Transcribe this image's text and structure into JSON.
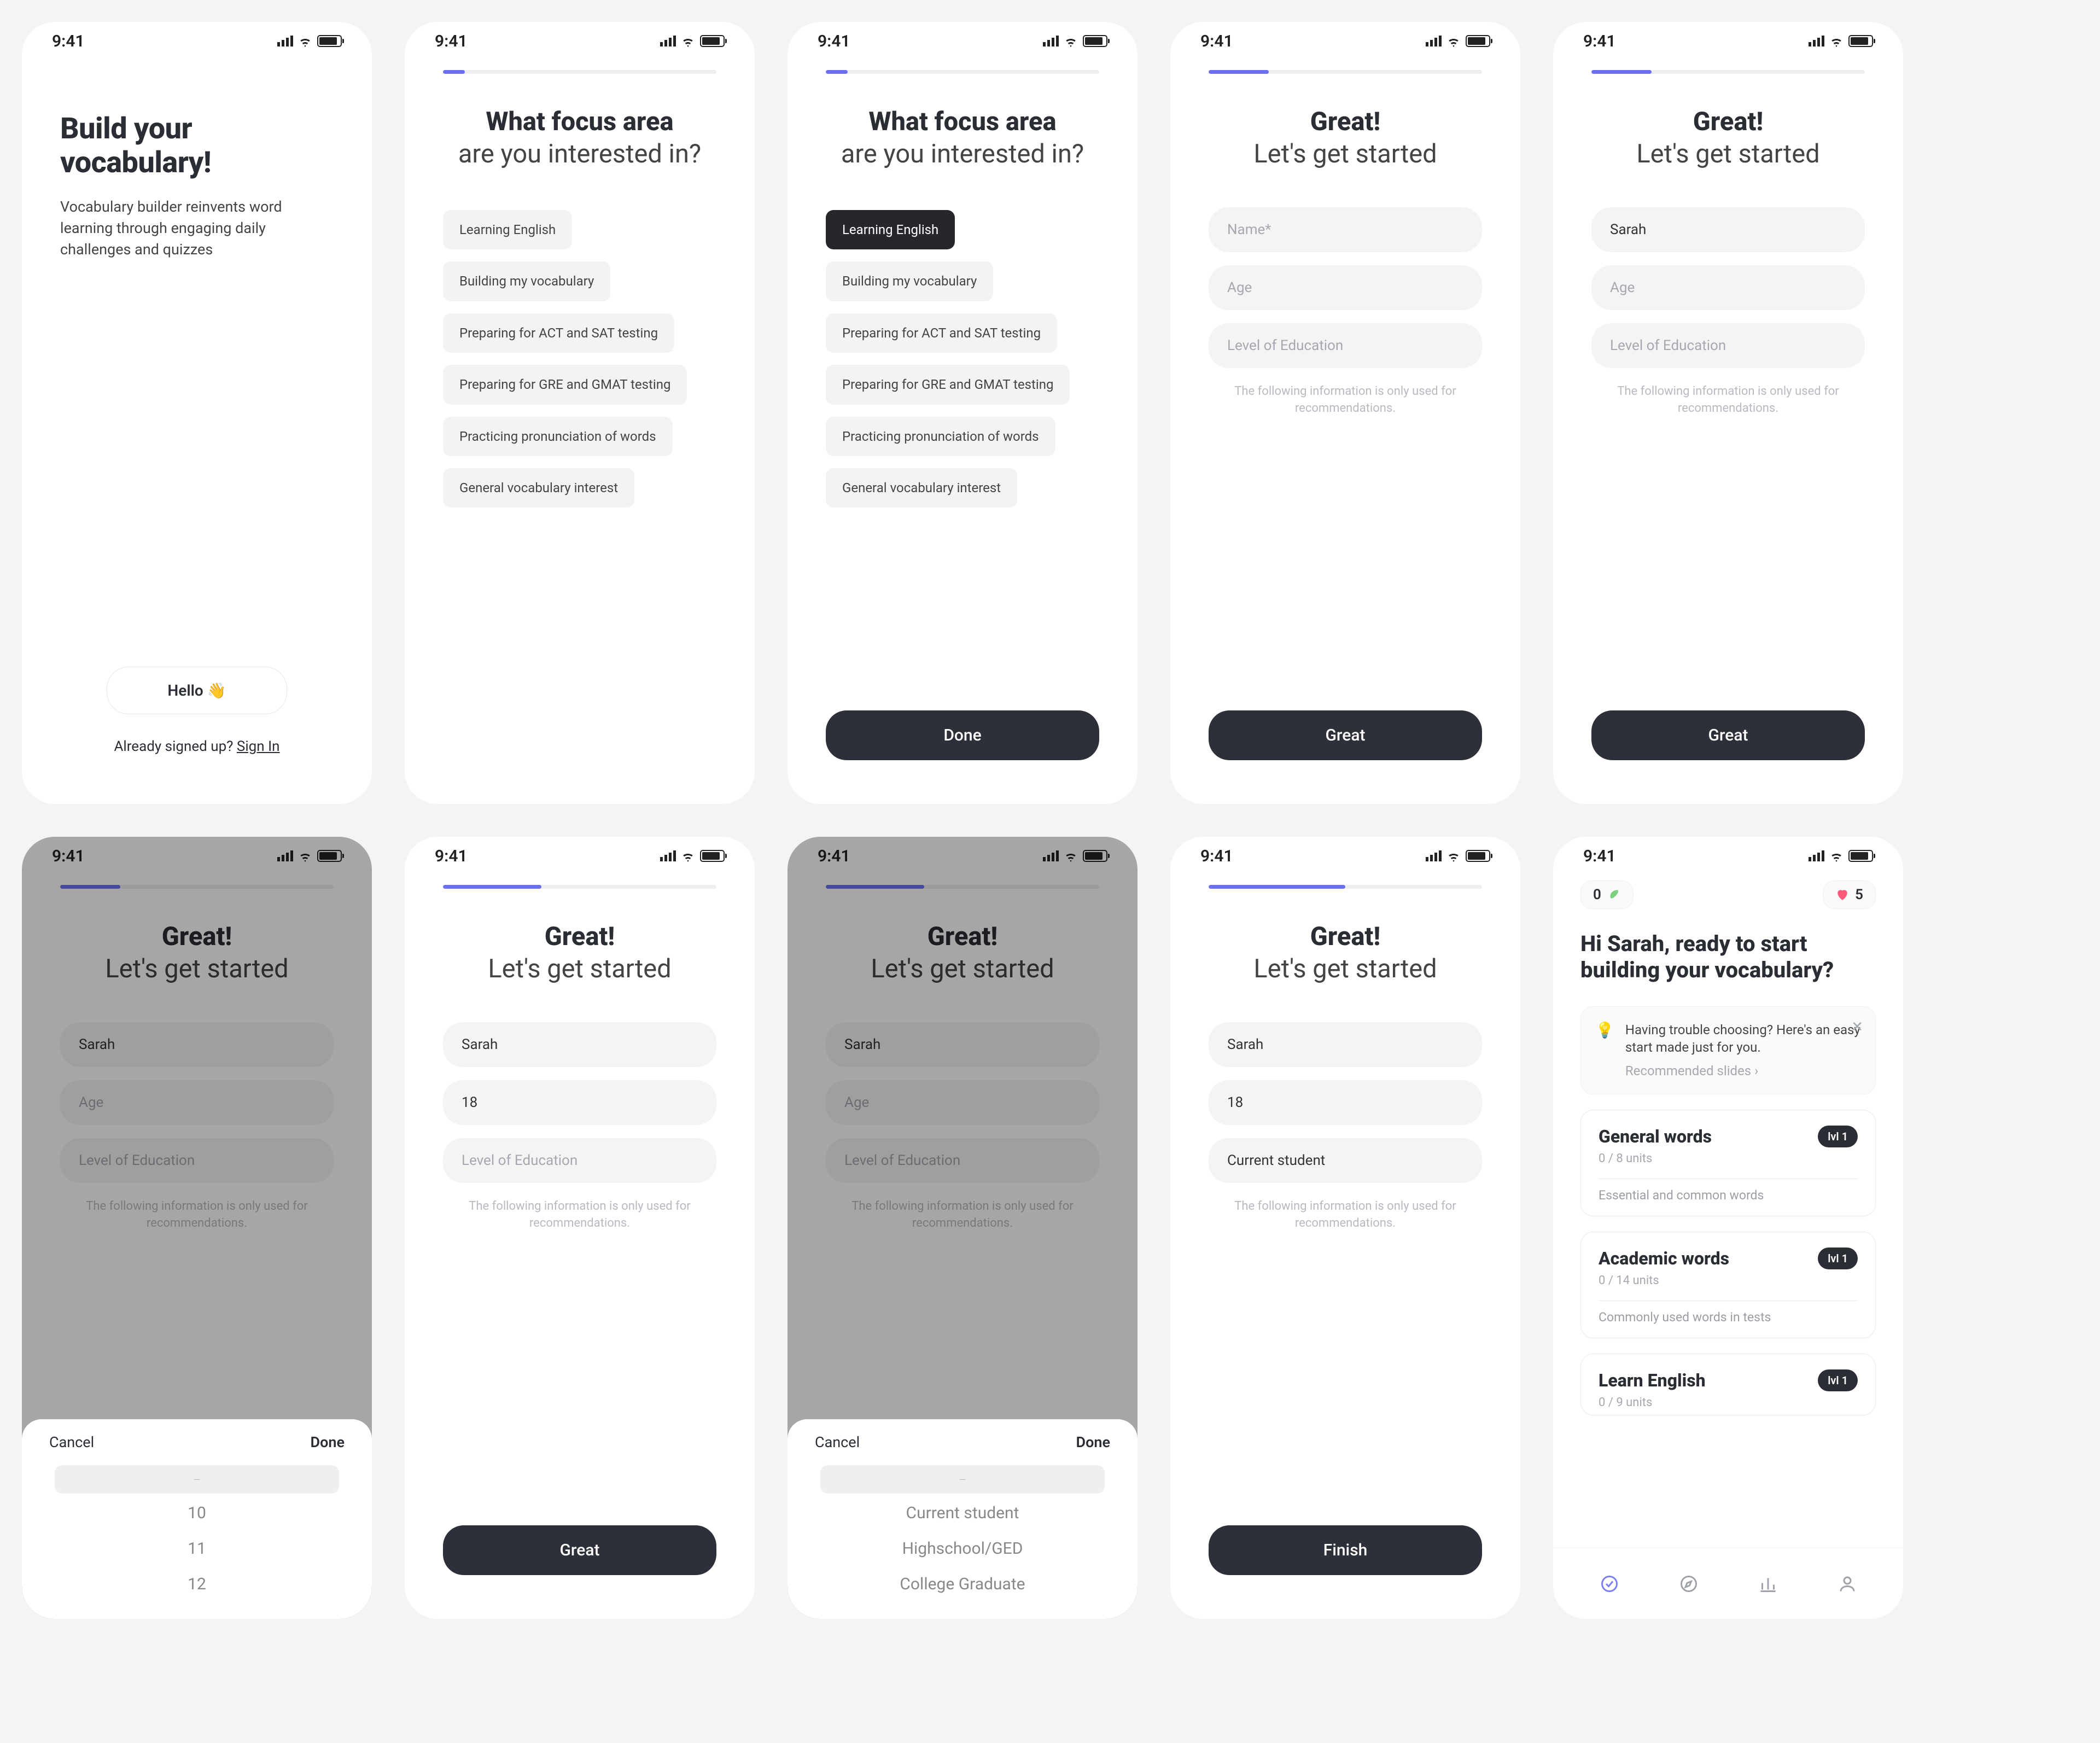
{
  "status": {
    "time": "9:41"
  },
  "welcome": {
    "title_line1": "Build your",
    "title_line2": "vocabulary!",
    "subtitle": "Vocabulary builder reinvents word learning through engaging daily challenges and quizzes",
    "hello_label": "Hello",
    "hello_emoji": "👋",
    "signin_prefix": "Already signed up? ",
    "signin_link": "Sign In"
  },
  "focus": {
    "title_line1": "What focus area",
    "title_line2": "are you interested in?",
    "options": [
      "Learning  English",
      "Building my vocabulary",
      "Preparing for ACT and SAT testing",
      "Preparing for GRE and GMAT testing",
      "Practicing pronunciation of words",
      "General vocabulary interest"
    ],
    "done_label": "Done"
  },
  "progress": {
    "p1": "8%",
    "p2": "22%",
    "p3": "36%",
    "p4": "50%"
  },
  "profile": {
    "title_line1": "Great!",
    "title_line2": "Let's get started",
    "placeholders": {
      "name": "Name*",
      "age": "Age",
      "edu": "Level of Education"
    },
    "values": {
      "name": "Sarah",
      "age": "18",
      "edu": "Current student"
    },
    "hint": "The following information is only used for recommendations.",
    "great_label": "Great",
    "finish_label": "Finish"
  },
  "picker": {
    "cancel": "Cancel",
    "done": "Done",
    "age_options": [
      "—",
      "10",
      "11",
      "12"
    ],
    "edu_options": [
      "—",
      "Current student",
      "Highschool/GED",
      "College Graduate"
    ]
  },
  "dashboard": {
    "streak": "0",
    "hearts": "5",
    "greeting": "Hi Sarah, ready to start building your vocabulary?",
    "notice_line": "Having trouble choosing? Here's an easy start made just for you.",
    "notice_rec": "Recommended slides  ›",
    "cards": [
      {
        "title": "General words",
        "units": "0 / 8 units",
        "lvl": "lvl 1",
        "desc": "Essential and common words"
      },
      {
        "title": "Academic words",
        "units": "0 / 14 units",
        "lvl": "lvl 1",
        "desc": "Commonly used words in tests"
      },
      {
        "title": "Learn English",
        "units": "0 / 9 units",
        "lvl": "lvl 1",
        "desc": ""
      }
    ]
  }
}
